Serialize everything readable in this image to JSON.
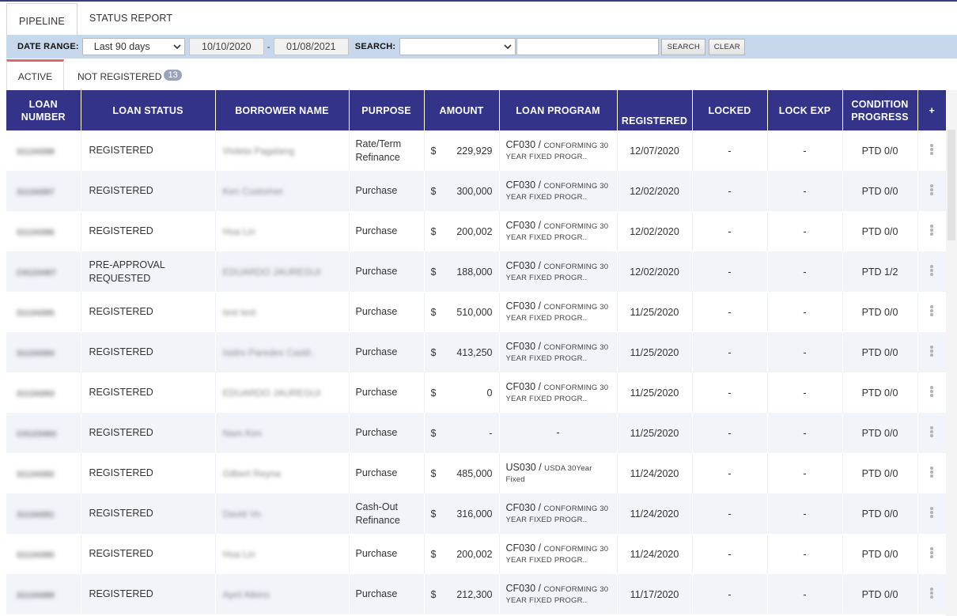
{
  "top_tabs": [
    {
      "label": "PIPELINE",
      "active": true
    },
    {
      "label": "STATUS REPORT",
      "active": false
    }
  ],
  "filter": {
    "date_range_label": "DATE RANGE:",
    "date_range_value": "Last 90 days",
    "date_from": "10/10/2020",
    "date_separator": "-",
    "date_to": "01/08/2021",
    "search_label": "SEARCH:",
    "search_select_value": "",
    "search_input_value": "",
    "search_button": "SEARCH",
    "clear_button": "CLEAR"
  },
  "sub_tabs": {
    "active_label": "ACTIVE",
    "not_registered_label": "NOT REGISTERED",
    "not_registered_count": "13"
  },
  "table": {
    "headers": {
      "loan_number_1": "LOAN",
      "loan_number_2": "NUMBER",
      "loan_status": "LOAN STATUS",
      "borrower_name": "BORROWER NAME",
      "purpose": "PURPOSE",
      "amount": "AMOUNT",
      "loan_program": "LOAN PROGRAM",
      "registered": "REGISTERED",
      "locked": "LOCKED",
      "lock_exp": "LOCK EXP",
      "condition_1": "CONDITION",
      "condition_2": "PROGRESS",
      "add": "+"
    },
    "rows": [
      {
        "loan": "31134398",
        "status_1": "REGISTERED",
        "status_2": "",
        "borrower": "Violeta Pagalang",
        "purpose_1": "Rate/Term",
        "purpose_2": "Refinance",
        "currency": "$",
        "amount": "229,929",
        "program_code": "CF030 /",
        "program_desc_1": "CONFORMING 30",
        "program_desc_2": "YEAR FIXED PROGR..",
        "registered": "12/07/2020",
        "locked": "-",
        "lock_exp": "-",
        "condition": "PTD 0/0"
      },
      {
        "loan": "31134397",
        "status_1": "REGISTERED",
        "status_2": "",
        "borrower": "Ken Customer",
        "purpose_1": "Purchase",
        "purpose_2": "",
        "currency": "$",
        "amount": "300,000",
        "program_code": "CF030 /",
        "program_desc_1": "CONFORMING 30",
        "program_desc_2": "YEAR FIXED PROGR..",
        "registered": "12/02/2020",
        "locked": "-",
        "lock_exp": "-",
        "condition": "PTD 0/0"
      },
      {
        "loan": "31134396",
        "status_1": "REGISTERED",
        "status_2": "",
        "borrower": "Hoa Lin",
        "purpose_1": "Purchase",
        "purpose_2": "",
        "currency": "$",
        "amount": "200,002",
        "program_code": "CF030 /",
        "program_desc_1": "CONFORMING 30",
        "program_desc_2": "YEAR FIXED PROGR..",
        "registered": "12/02/2020",
        "locked": "-",
        "lock_exp": "-",
        "condition": "PTD 0/0"
      },
      {
        "loan": "C0123497",
        "status_1": "PRE-APPROVAL",
        "status_2": "REQUESTED",
        "borrower": "EDUARDO JAUREGUI",
        "purpose_1": "Purchase",
        "purpose_2": "",
        "currency": "$",
        "amount": "188,000",
        "program_code": "CF030 /",
        "program_desc_1": "CONFORMING 30",
        "program_desc_2": "YEAR FIXED PROGR..",
        "registered": "12/02/2020",
        "locked": "-",
        "lock_exp": "-",
        "condition": "PTD 1/2"
      },
      {
        "loan": "31134395",
        "status_1": "REGISTERED",
        "status_2": "",
        "borrower": "test test",
        "purpose_1": "Purchase",
        "purpose_2": "",
        "currency": "$",
        "amount": "510,000",
        "program_code": "CF030 /",
        "program_desc_1": "CONFORMING 30",
        "program_desc_2": "YEAR FIXED PROGR..",
        "registered": "11/25/2020",
        "locked": "-",
        "lock_exp": "-",
        "condition": "PTD 0/0"
      },
      {
        "loan": "31134394",
        "status_1": "REGISTERED",
        "status_2": "",
        "borrower": "Isidro Paredes Castil..",
        "purpose_1": "Purchase",
        "purpose_2": "",
        "currency": "$",
        "amount": "413,250",
        "program_code": "CF030 /",
        "program_desc_1": "CONFORMING 30",
        "program_desc_2": "YEAR FIXED PROGR..",
        "registered": "11/25/2020",
        "locked": "-",
        "lock_exp": "-",
        "condition": "PTD 0/0"
      },
      {
        "loan": "31134393",
        "status_1": "REGISTERED",
        "status_2": "",
        "borrower": "EDUARDO JAUREGUI",
        "purpose_1": "Purchase",
        "purpose_2": "",
        "currency": "$",
        "amount": "0",
        "program_code": "CF030 /",
        "program_desc_1": "CONFORMING 30",
        "program_desc_2": "YEAR FIXED PROGR..",
        "registered": "11/25/2020",
        "locked": "-",
        "lock_exp": "-",
        "condition": "PTD 0/0"
      },
      {
        "loan": "C0123494",
        "status_1": "REGISTERED",
        "status_2": "",
        "borrower": "Nam Kim",
        "purpose_1": "Purchase",
        "purpose_2": "",
        "currency": "$",
        "amount": "-",
        "program_code": "-",
        "program_desc_1": "",
        "program_desc_2": "",
        "registered": "11/25/2020",
        "locked": "-",
        "lock_exp": "-",
        "condition": "PTD 0/0"
      },
      {
        "loan": "31134392",
        "status_1": "REGISTERED",
        "status_2": "",
        "borrower": "Gilbert Reyna",
        "purpose_1": "Purchase",
        "purpose_2": "",
        "currency": "$",
        "amount": "485,000",
        "program_code": "US030 /",
        "program_desc_1": "USDA 30Year",
        "program_desc_2": "Fixed",
        "registered": "11/24/2020",
        "locked": "-",
        "lock_exp": "-",
        "condition": "PTD 0/0"
      },
      {
        "loan": "31134391",
        "status_1": "REGISTERED",
        "status_2": "",
        "borrower": "David Vo",
        "purpose_1": "Cash-Out",
        "purpose_2": "Refinance",
        "currency": "$",
        "amount": "316,000",
        "program_code": "CF030 /",
        "program_desc_1": "CONFORMING 30",
        "program_desc_2": "YEAR FIXED PROGR..",
        "registered": "11/24/2020",
        "locked": "-",
        "lock_exp": "-",
        "condition": "PTD 0/0"
      },
      {
        "loan": "31134390",
        "status_1": "REGISTERED",
        "status_2": "",
        "borrower": "Hoa Lin",
        "purpose_1": "Purchase",
        "purpose_2": "",
        "currency": "$",
        "amount": "200,002",
        "program_code": "CF030 /",
        "program_desc_1": "CONFORMING 30",
        "program_desc_2": "YEAR FIXED PROGR..",
        "registered": "11/24/2020",
        "locked": "-",
        "lock_exp": "-",
        "condition": "PTD 0/0"
      },
      {
        "loan": "31134389",
        "status_1": "REGISTERED",
        "status_2": "",
        "borrower": "April Atkins",
        "purpose_1": "Purchase",
        "purpose_2": "",
        "currency": "$",
        "amount": "212,300",
        "program_code": "CF030 /",
        "program_desc_1": "CONFORMING 30",
        "program_desc_2": "YEAR FIXED PROGR..",
        "registered": "11/17/2020",
        "locked": "-",
        "lock_exp": "-",
        "condition": "PTD 0/0"
      }
    ]
  },
  "colors": {
    "header_bg": "#33338a",
    "filter_bar_bg": "#c7d7ec",
    "active_tab_accent": "#e46474",
    "badge_bg": "#9aa4b8"
  },
  "icons": {
    "row_menu": "kebab-menu-icon",
    "dropdown": "chevron-down-icon"
  }
}
